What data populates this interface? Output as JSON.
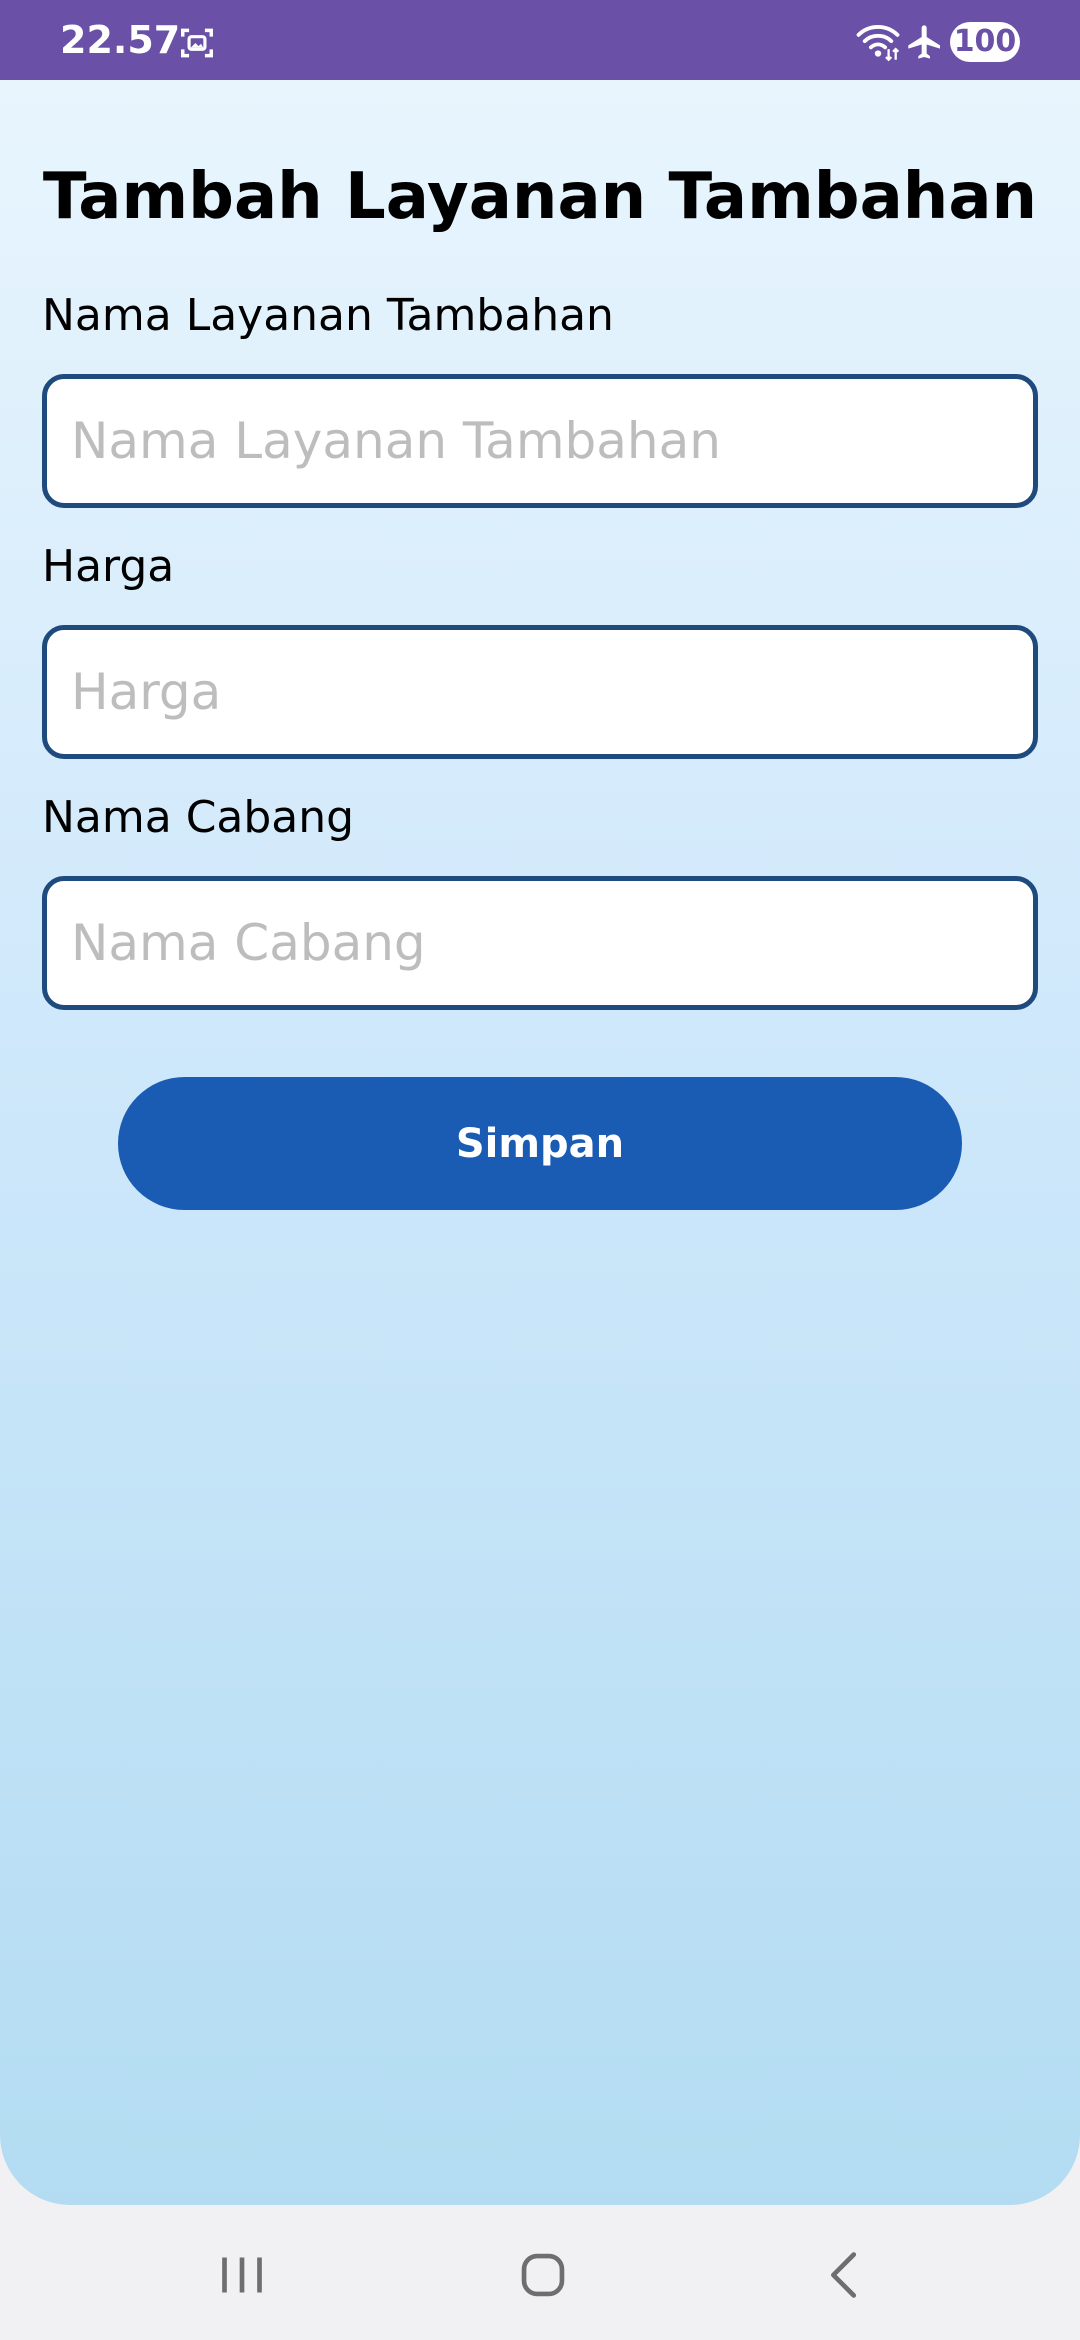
{
  "status_bar": {
    "time": "22.57",
    "battery": "100"
  },
  "page": {
    "title": "Tambah Layanan Tambahan"
  },
  "form": {
    "fields": [
      {
        "label": "Nama Layanan Tambahan",
        "placeholder": "Nama Layanan Tambahan",
        "value": ""
      },
      {
        "label": "Harga",
        "placeholder": "Harga",
        "value": ""
      },
      {
        "label": "Nama Cabang",
        "placeholder": "Nama Cabang",
        "value": ""
      }
    ],
    "submit_label": "Simpan"
  },
  "nav": {
    "icons": [
      "recent-apps-icon",
      "home-icon",
      "back-icon"
    ]
  },
  "colors": {
    "status_bar": "#6a50a6",
    "button": "#1a5bb3",
    "input_border": "#1f4a7e",
    "background_top": "#e8f5fd",
    "background_bottom": "#b3dcf2"
  }
}
